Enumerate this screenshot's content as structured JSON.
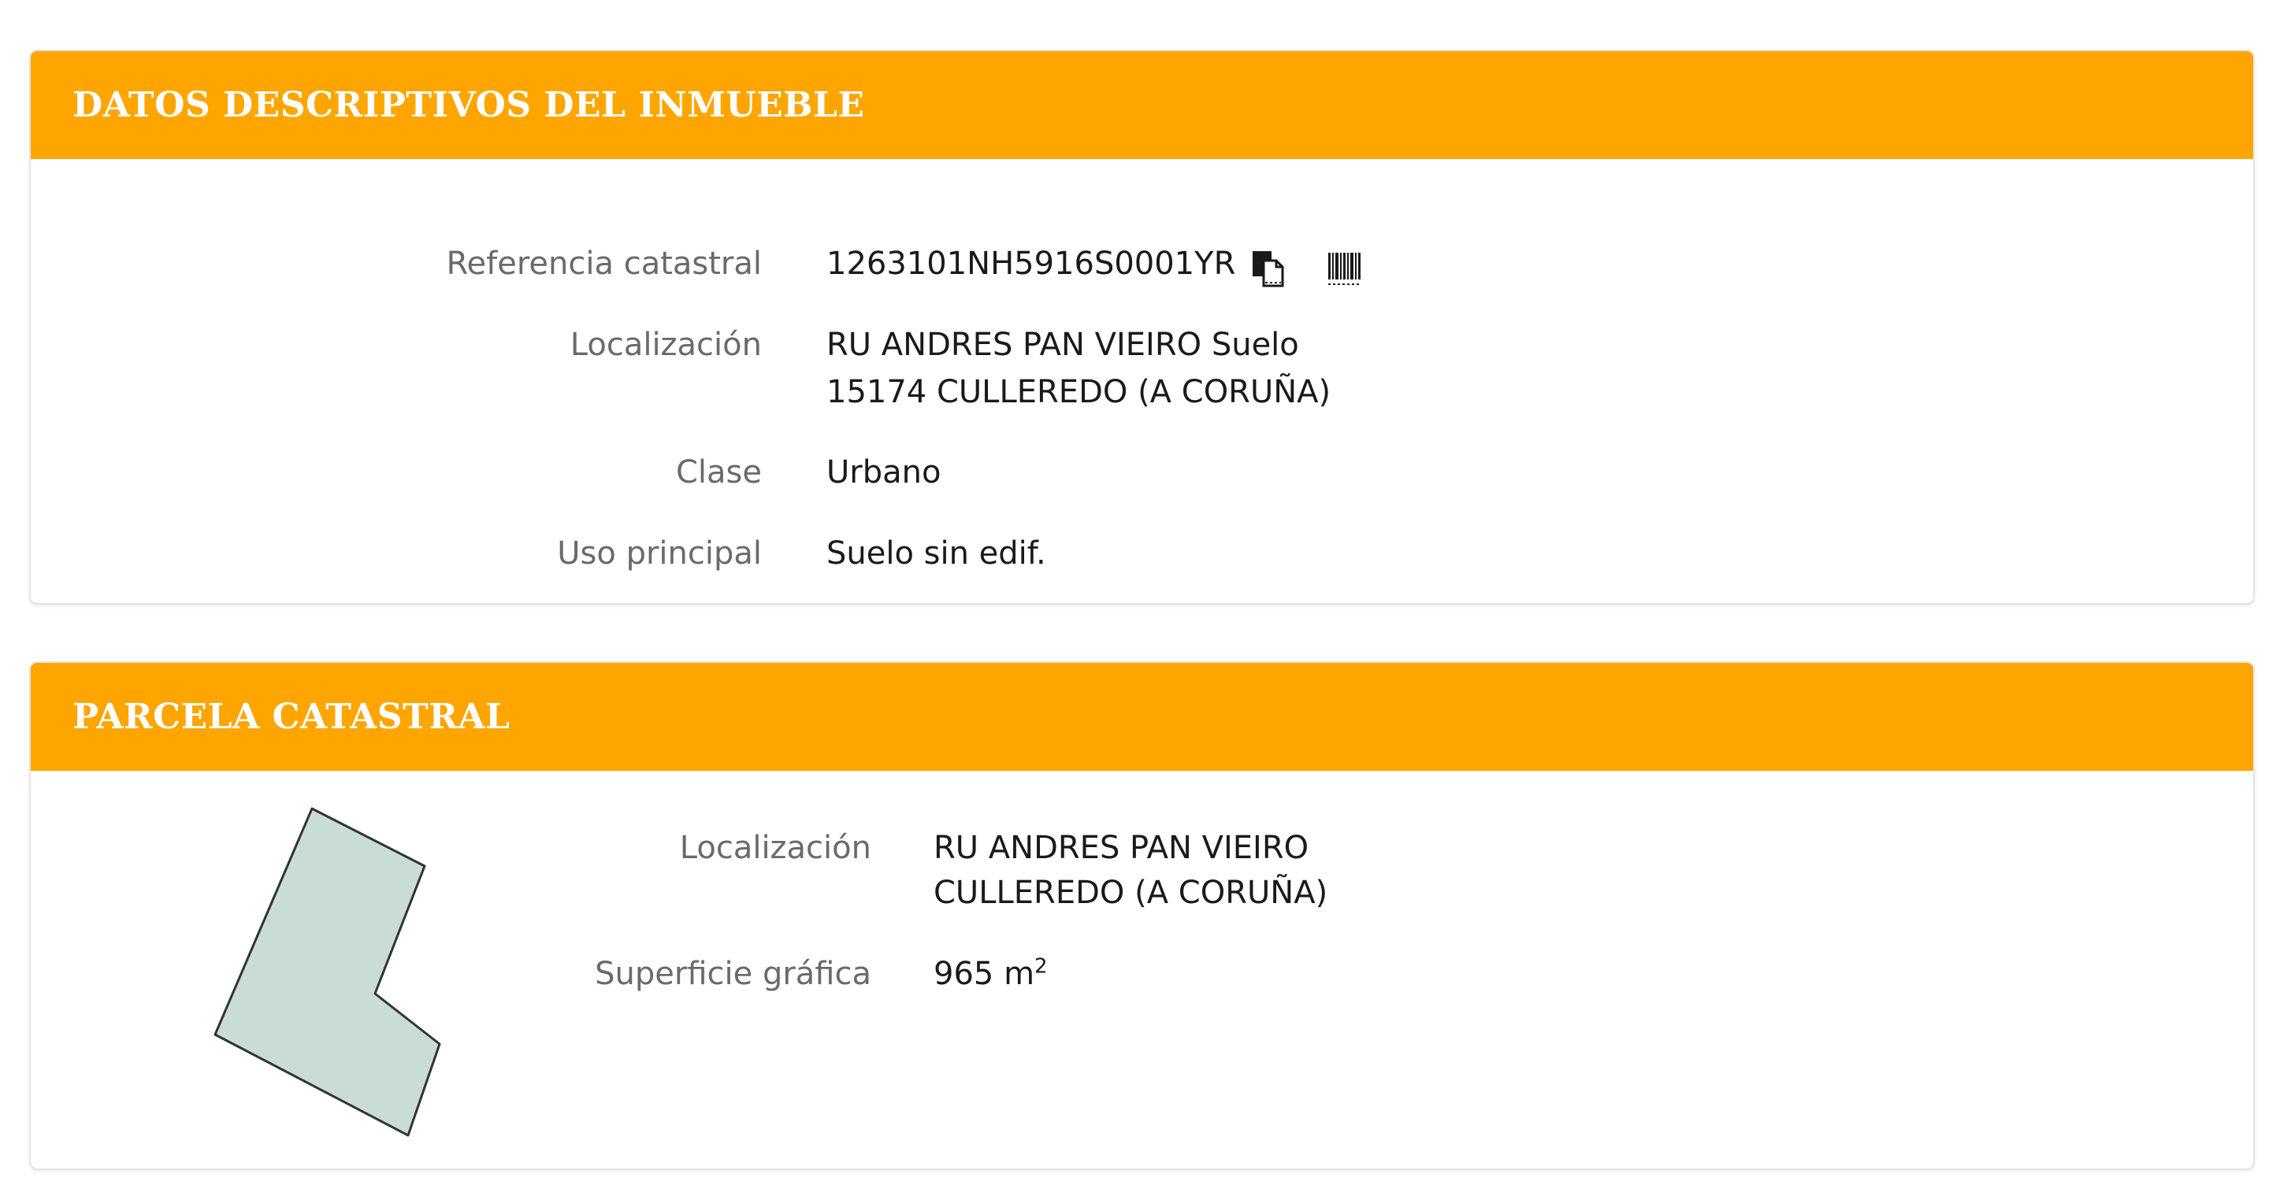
{
  "datos": {
    "title": "DATOS DESCRIPTIVOS DEL INMUEBLE",
    "referencia": {
      "label": "Referencia catastral",
      "value": "1263101NH5916S0001YR"
    },
    "localizacion": {
      "label": "Localización",
      "line1": "RU ANDRES PAN VIEIRO Suelo",
      "line2": "15174 CULLEREDO (A CORUÑA)"
    },
    "clase": {
      "label": "Clase",
      "value": "Urbano"
    },
    "uso": {
      "label": "Uso principal",
      "value": "Suelo sin edif."
    }
  },
  "parcela": {
    "title": "PARCELA CATASTRAL",
    "localizacion": {
      "label": "Localización",
      "line1": "RU ANDRES PAN VIEIRO",
      "line2": "CULLEREDO (A CORUÑA)"
    },
    "superficie": {
      "label": "Superficie gráfica",
      "value": "965 m",
      "unit_sup": "2"
    }
  },
  "icons": {
    "copy": "copy-icon",
    "barcode": "barcode-icon"
  },
  "colors": {
    "header": "#ffa500",
    "parcel_fill": "#c9ddd6",
    "parcel_stroke": "#333333"
  }
}
